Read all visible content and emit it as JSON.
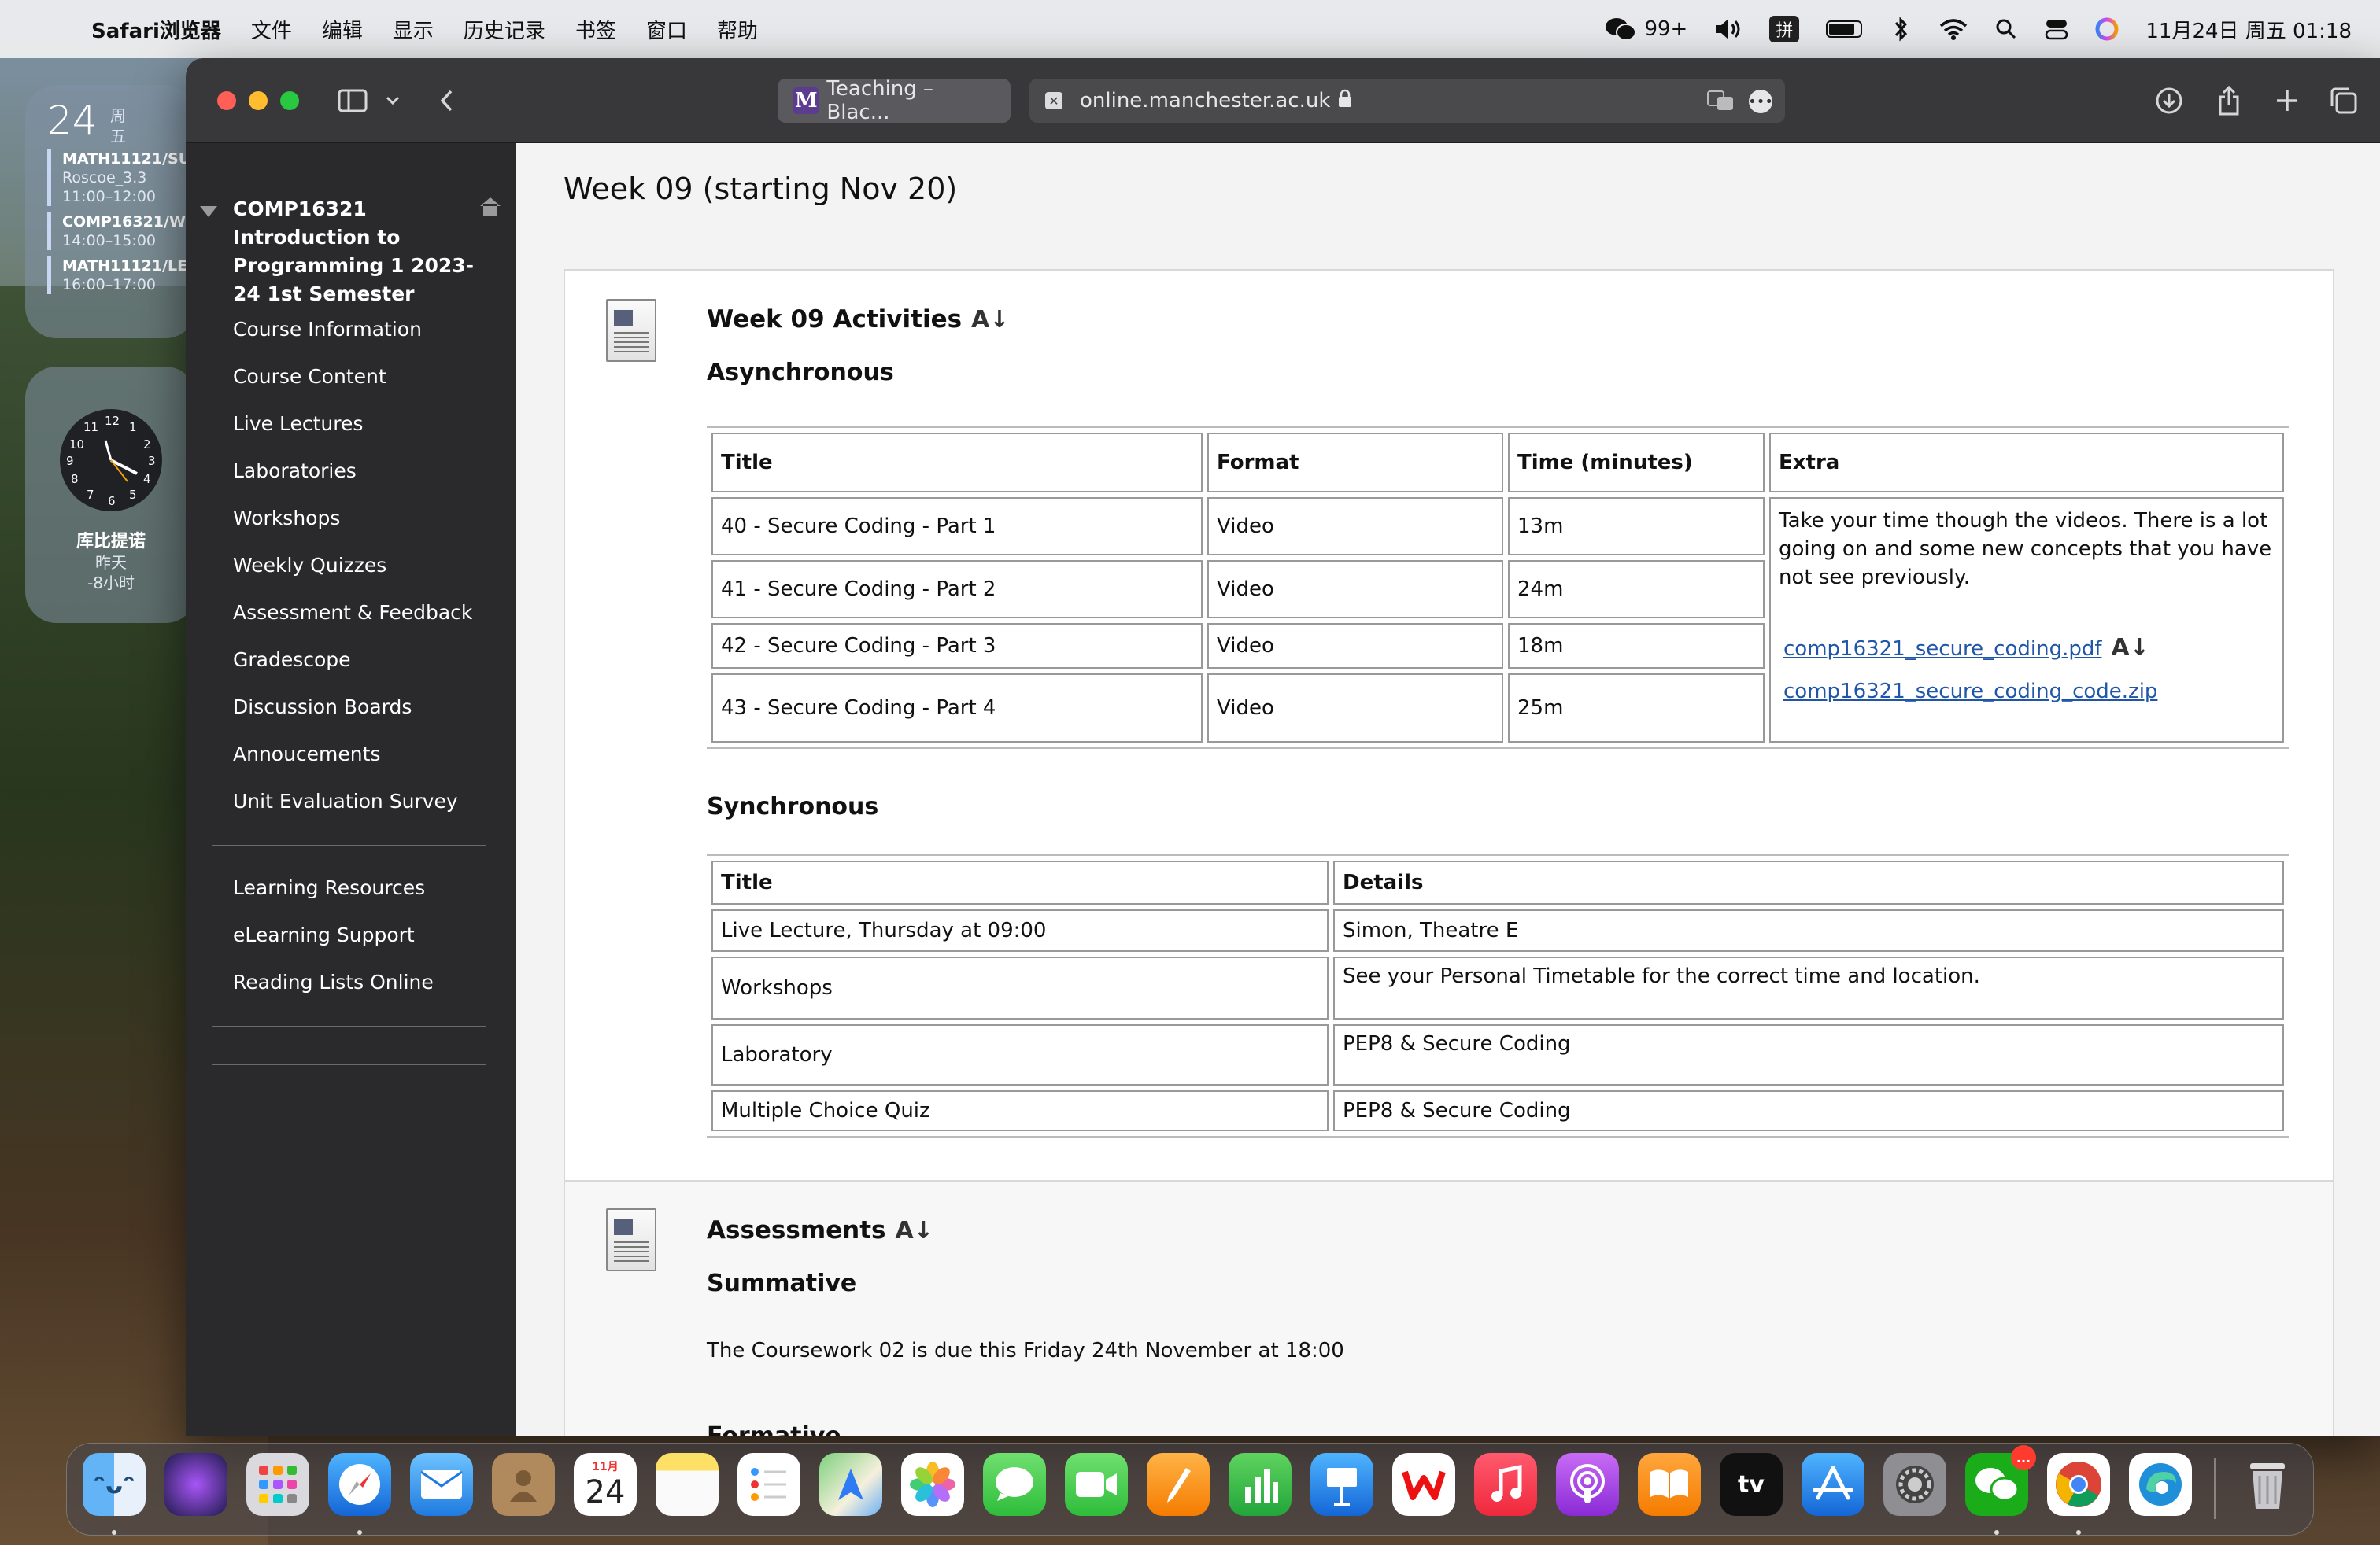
{
  "menubar": {
    "app_name": "Safari浏览器",
    "items": [
      "文件",
      "编辑",
      "显示",
      "历史记录",
      "书签",
      "窗口",
      "帮助"
    ],
    "wechat_count": "99+",
    "ime": "拼",
    "datetime": "11月24日 周五 01:18"
  },
  "widgets": {
    "calendar": {
      "day": "24",
      "dow_1": "周",
      "dow_2": "五",
      "events": [
        {
          "title": "MATH11121/SU",
          "sub1": "Roscoe_3.3",
          "sub2": "11:00–12:00"
        },
        {
          "title": "COMP16321/W",
          "sub1": "14:00–15:00"
        },
        {
          "title": "MATH11121/LE",
          "sub1": "16:00–17:00"
        }
      ]
    },
    "clock": {
      "city": "库比提诺",
      "day": "昨天",
      "offset": "-8小时",
      "numbers": [
        "12",
        "1",
        "2",
        "3",
        "4",
        "5",
        "6",
        "7",
        "8",
        "9",
        "10",
        "11"
      ]
    }
  },
  "browser": {
    "tab_title": "Teaching – Blac...",
    "tab_logo": "M",
    "address": "online.manchester.ac.uk"
  },
  "sidebar": {
    "course_title": "COMP16321 Introduction to Programming 1 2023-24 1st Semester",
    "nav": [
      "Course Information",
      "Course Content",
      "Live Lectures",
      "Laboratories",
      "Workshops",
      "Weekly Quizzes",
      "Assessment & Feedback",
      "Gradescope",
      "Discussion Boards",
      "Annoucements",
      "Unit Evaluation Survey"
    ],
    "nav2": [
      "Learning Resources",
      "eLearning Support",
      "Reading Lists Online"
    ]
  },
  "content": {
    "week_title": "Week 09 (starting Nov 20)",
    "activities": {
      "title": "Week 09 Activities",
      "async_heading": "Asynchronous",
      "async_headers": [
        "Title",
        "Format",
        "Time (minutes)",
        "Extra"
      ],
      "async_rows": [
        [
          "40 - Secure Coding - Part 1",
          "Video",
          "13m"
        ],
        [
          "41 - Secure Coding - Part 2",
          "Video",
          "24m"
        ],
        [
          "42 - Secure Coding - Part 3",
          "Video",
          "18m"
        ],
        [
          "43 - Secure Coding - Part 4",
          "Video",
          "25m"
        ]
      ],
      "extra_text": "Take your time though the videos.  There is a lot going on and some new concepts that you have not see previously.",
      "link1": "comp16321_secure_coding.pdf",
      "link2": "comp16321_secure_coding_code.zip",
      "sync_heading": "Synchronous",
      "sync_headers": [
        "Title",
        "Details"
      ],
      "sync_rows": [
        [
          "Live Lecture, Thursday at 09:00",
          "Simon, Theatre E"
        ],
        [
          "Workshops",
          "See your Personal Timetable for the correct time and location."
        ],
        [
          "Laboratory",
          "PEP8 & Secure Coding"
        ],
        [
          "Multiple Choice Quiz",
          "PEP8 & Secure Coding"
        ]
      ]
    },
    "assessments": {
      "title": "Assessments",
      "summative": "Summative",
      "summative_text": "The Coursework 02 is due this Friday 24th November at 18:00",
      "formative": "Formative"
    }
  },
  "dock": {
    "calendar_month": "11月",
    "calendar_day": "24",
    "tv_label": "tv",
    "wechat_badge": "..."
  }
}
